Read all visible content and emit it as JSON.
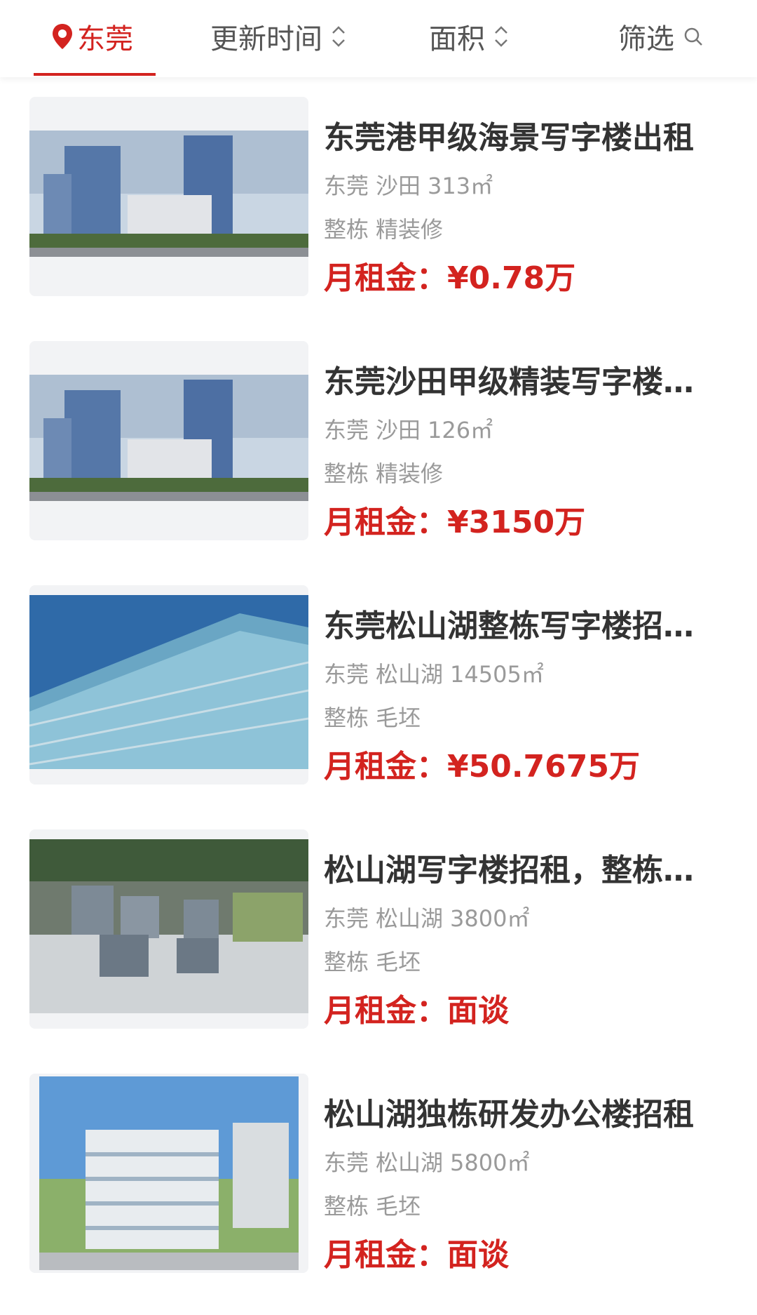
{
  "filters": {
    "city": "东莞",
    "update_time": "更新时间",
    "area": "面积",
    "filter": "筛选"
  },
  "colors": {
    "accent": "#d3231f",
    "text": "#333333",
    "muted": "#9a9a9a"
  },
  "price_label": "月租金：",
  "listings": [
    {
      "title": "东莞港甲级海景写字楼出租",
      "city": "东莞",
      "district": "沙田",
      "area": "313㎡",
      "type": "整栋",
      "decoration": "精装修",
      "price": "¥0.78万"
    },
    {
      "title": "东莞沙田甲级精装写字楼…",
      "city": "东莞",
      "district": "沙田",
      "area": "126㎡",
      "type": "整栋",
      "decoration": "精装修",
      "price": "¥3150万"
    },
    {
      "title": "东莞松山湖整栋写字楼招…",
      "city": "东莞",
      "district": "松山湖",
      "area": "14505㎡",
      "type": "整栋",
      "decoration": "毛坯",
      "price": "¥50.7675万"
    },
    {
      "title": "松山湖写字楼招租，整栋…",
      "city": "东莞",
      "district": "松山湖",
      "area": "3800㎡",
      "type": "整栋",
      "decoration": "毛坯",
      "price": "面谈"
    },
    {
      "title": "松山湖独栋研发办公楼招租",
      "city": "东莞",
      "district": "松山湖",
      "area": "5800㎡",
      "type": "整栋",
      "decoration": "毛坯",
      "price": "面谈"
    }
  ]
}
